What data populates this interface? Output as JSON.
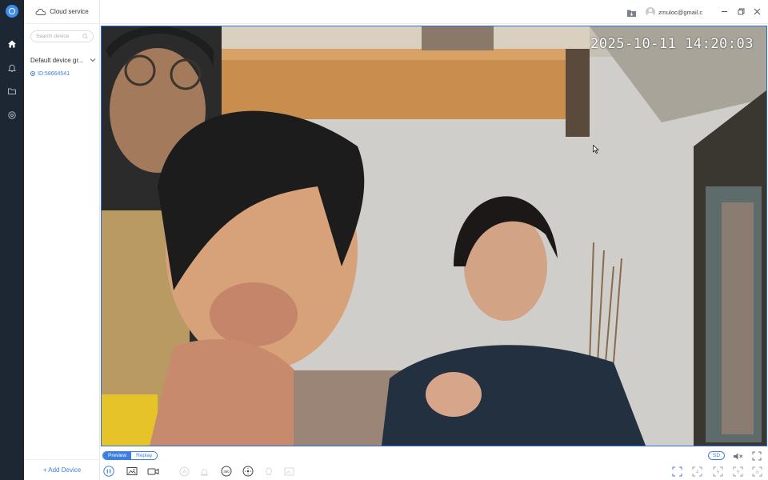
{
  "app": {
    "cloud_label": "Cloud service",
    "account": "zmuloc@gmail.c"
  },
  "sidebar": {
    "search_placeholder": "Search device",
    "group_label": "Default device gr...",
    "device_id": "ID:58664541",
    "add_device_label": "+ Add Device"
  },
  "video": {
    "timestamp": "2025-10-11  14:20:03"
  },
  "toolbar": {
    "tabs": [
      {
        "label": "Preview",
        "active": true
      },
      {
        "label": "Replay",
        "active": false
      }
    ],
    "quality": "SD"
  },
  "colors": {
    "accent": "#3d7fe0",
    "rail": "#1d2733"
  }
}
